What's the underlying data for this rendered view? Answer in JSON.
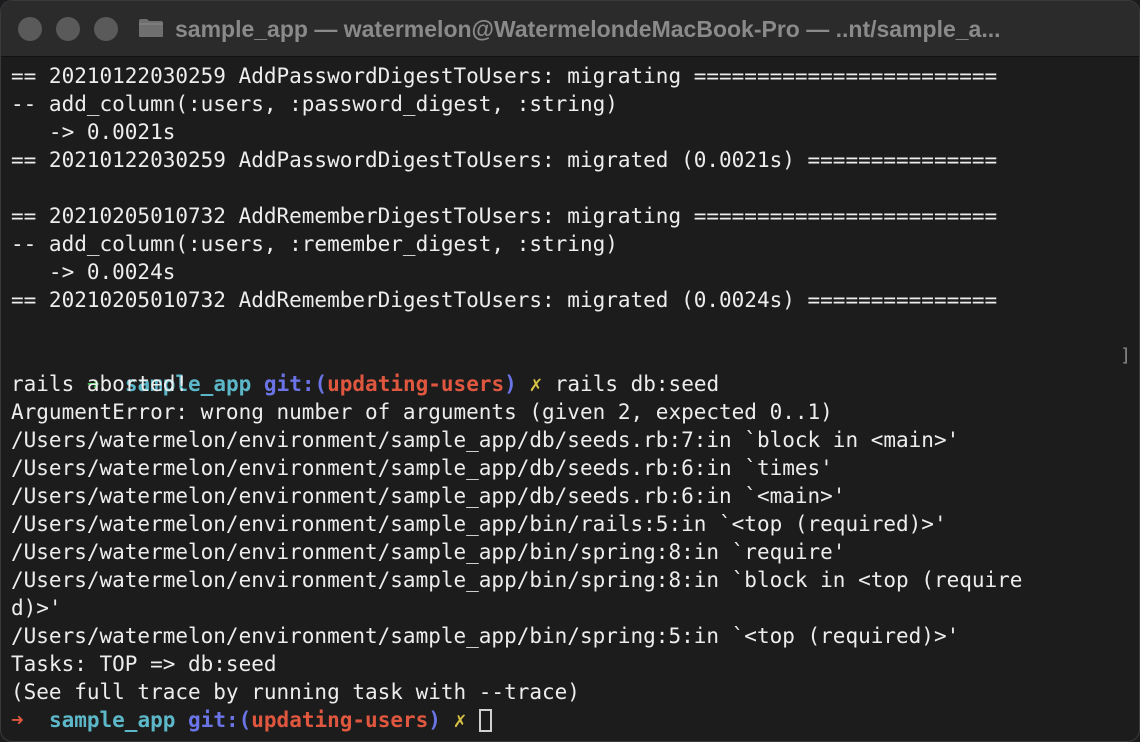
{
  "window": {
    "title": "sample_app — watermelon@WatermelondeMacBook-Pro — ..nt/sample_a..."
  },
  "colors": {
    "background": "#1c1c1c",
    "text": "#ededed",
    "prompt_arrow_ok": "#3fb950",
    "prompt_arrow_error": "#e0573f",
    "directory": "#5cb8c8",
    "git_label": "#6b74e6",
    "branch": "#e0573f",
    "dirty_marker": "#d7c244"
  },
  "icons": {
    "folder": "folder-icon",
    "prompt_arrow": "arrow-right",
    "dirty_marker": "cross-mark"
  },
  "terminal": {
    "output_before": [
      "== 20210122030259 AddPasswordDigestToUsers: migrating ========================",
      "-- add_column(:users, :password_digest, :string)",
      "   -> 0.0021s",
      "== 20210122030259 AddPasswordDigestToUsers: migrated (0.0021s) ===============",
      "",
      "== 20210205010732 AddRememberDigestToUsers: migrating ========================",
      "-- add_column(:users, :remember_digest, :string)",
      "   -> 0.0024s",
      "== 20210205010732 AddRememberDigestToUsers: migrated (0.0024s) ===============",
      ""
    ],
    "prompt1": {
      "mark_left": "[",
      "arrow": "➜",
      "dir": "sample_app",
      "git_label": "git:(",
      "branch": "updating-users",
      "git_close": ")",
      "dirty": "✗",
      "command": "rails db:seed",
      "mark_right": "]"
    },
    "output_after": [
      "rails aborted!",
      "ArgumentError: wrong number of arguments (given 2, expected 0..1)",
      "/Users/watermelon/environment/sample_app/db/seeds.rb:7:in `block in <main>'",
      "/Users/watermelon/environment/sample_app/db/seeds.rb:6:in `times'",
      "/Users/watermelon/environment/sample_app/db/seeds.rb:6:in `<main>'",
      "/Users/watermelon/environment/sample_app/bin/rails:5:in `<top (required)>'",
      "/Users/watermelon/environment/sample_app/bin/spring:8:in `require'",
      "/Users/watermelon/environment/sample_app/bin/spring:8:in `block in <top (require",
      "d)>'",
      "/Users/watermelon/environment/sample_app/bin/spring:5:in `<top (required)>'",
      "Tasks: TOP => db:seed",
      "(See full trace by running task with --trace)"
    ],
    "prompt2": {
      "arrow": "➜",
      "dir": "sample_app",
      "git_label": "git:(",
      "branch": "updating-users",
      "git_close": ")",
      "dirty": "✗"
    }
  }
}
